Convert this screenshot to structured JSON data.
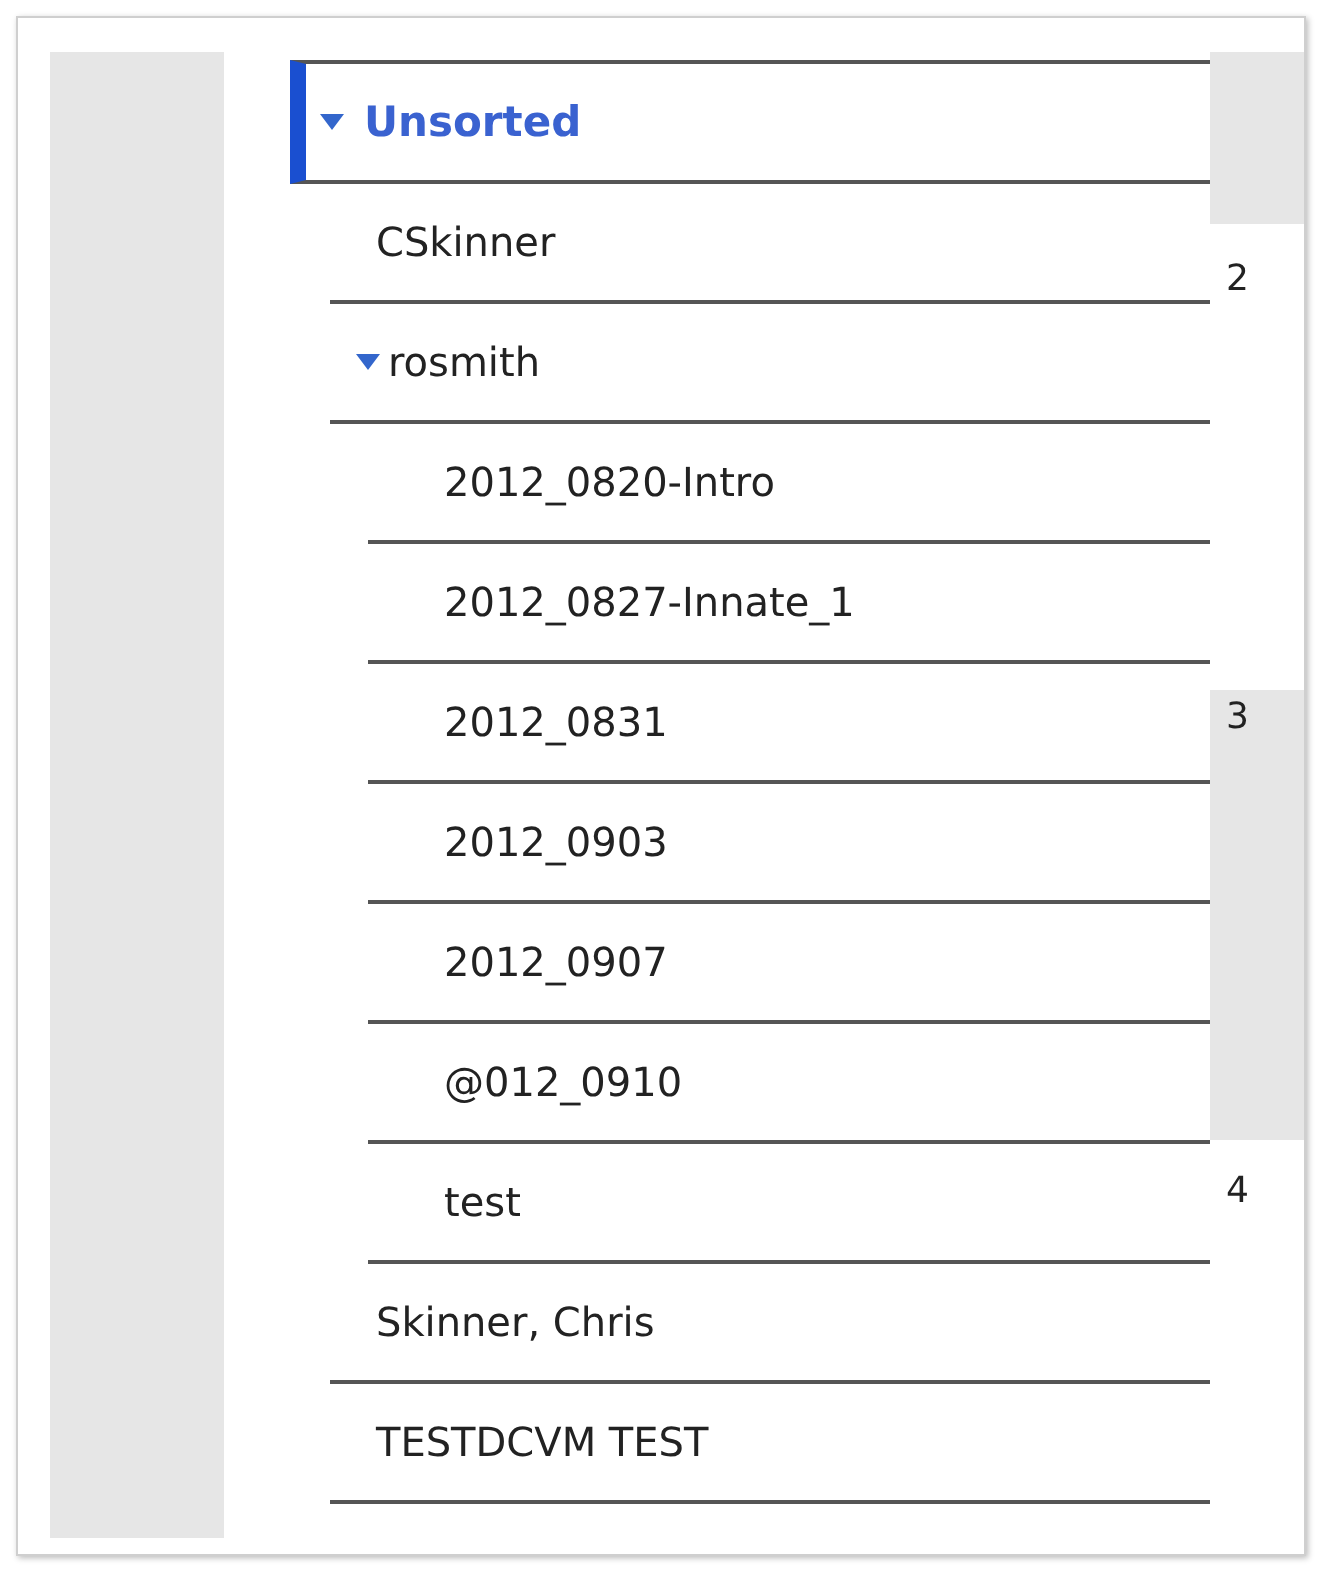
{
  "tree": [
    {
      "label": "Unsorted",
      "selected": true,
      "expanded": true,
      "children": [
        {
          "label": "CSkinner",
          "selected": false
        },
        {
          "label": "rosmith",
          "selected": false,
          "expanded": true,
          "children": [
            {
              "label": "2012_0820-Intro",
              "selected": false
            },
            {
              "label": "2012_0827-Innate_1",
              "selected": false
            },
            {
              "label": "2012_0831",
              "selected": false
            },
            {
              "label": "2012_0903",
              "selected": false
            },
            {
              "label": "2012_0907",
              "selected": false
            },
            {
              "label": "@012_0910",
              "selected": false
            },
            {
              "label": "test",
              "selected": false
            }
          ]
        },
        {
          "label": "Skinner, Chris",
          "selected": false
        },
        {
          "label": "TESTDCVM TEST",
          "selected": false
        }
      ]
    }
  ],
  "markers": [
    {
      "text": "2",
      "shaded": false
    },
    {
      "text": "3",
      "shaded": true
    },
    {
      "text": "4",
      "shaded": false
    }
  ]
}
